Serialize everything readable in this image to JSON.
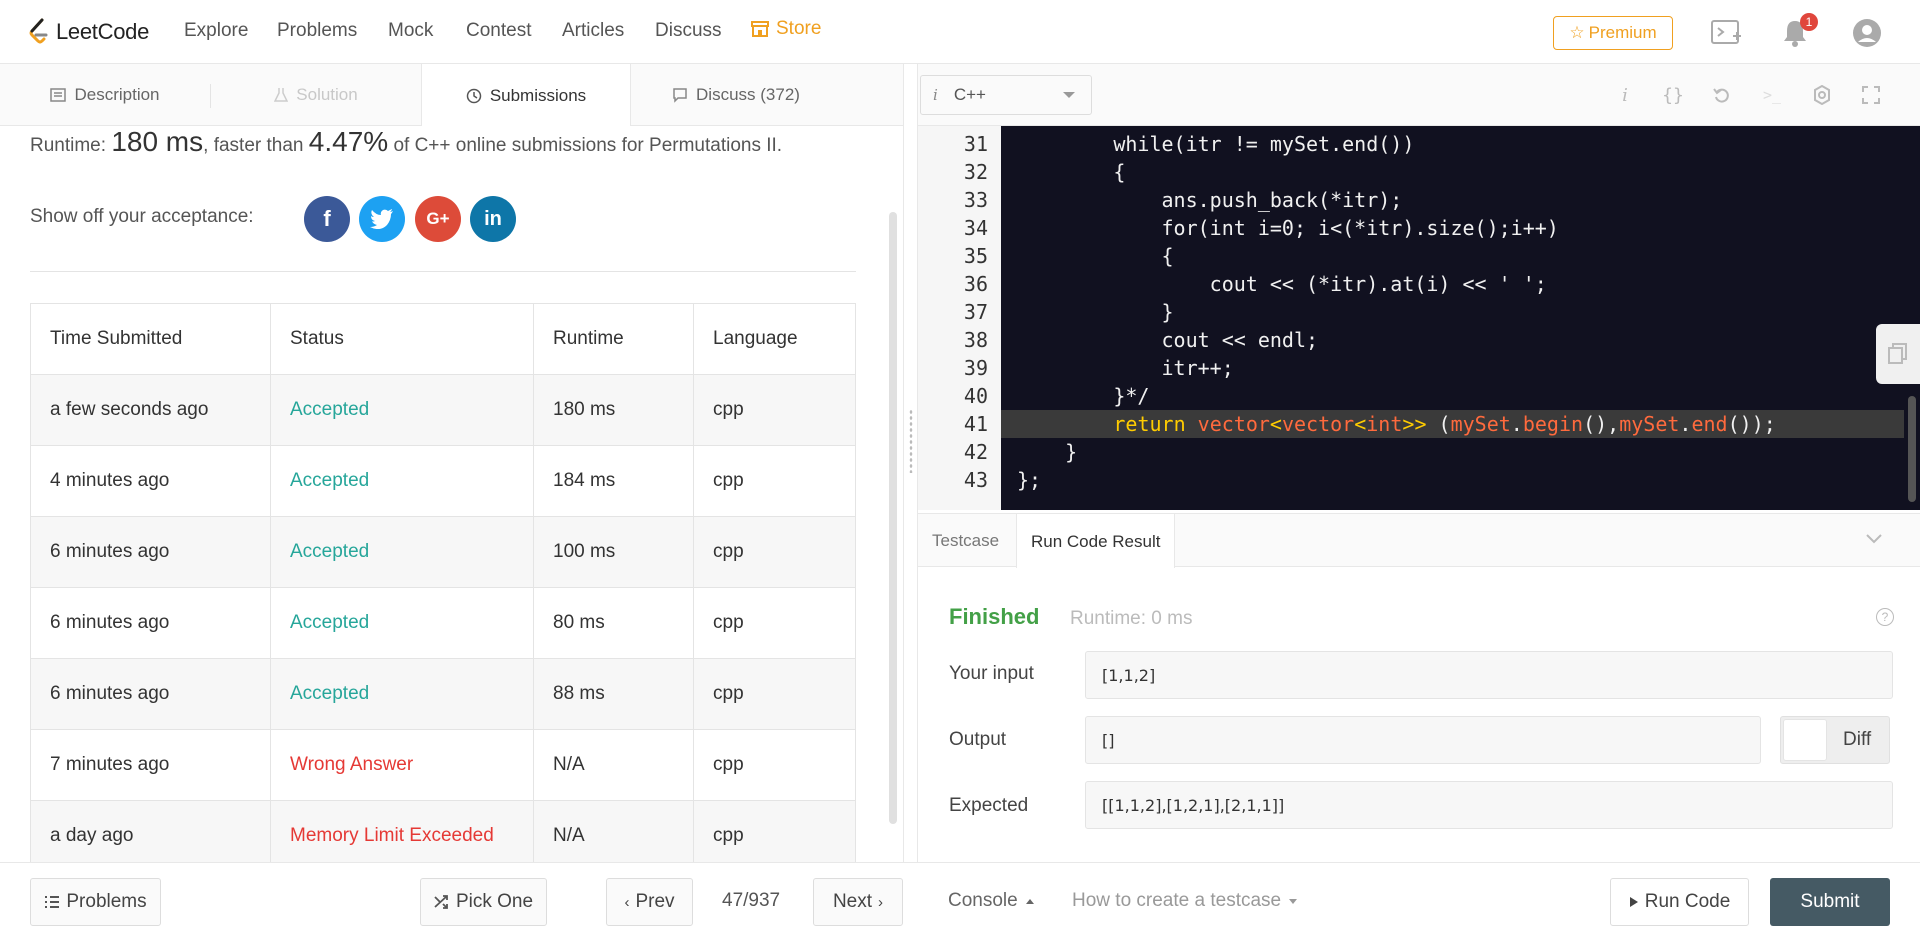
{
  "nav": {
    "logo_text": "LeetCode",
    "links": [
      "Explore",
      "Problems",
      "Mock",
      "Contest",
      "Articles",
      "Discuss"
    ],
    "store_label": "Store",
    "premium_label": "Premium",
    "notification_count": "1",
    "colors": {
      "store": "#f0a020",
      "premium": "#f0a020",
      "badge": "#e0463c"
    },
    "icons": [
      "playground-icon",
      "bell-icon",
      "user-avatar-icon"
    ]
  },
  "left_tabs": [
    {
      "label": "Description",
      "icon": "document-icon",
      "state": "normal"
    },
    {
      "label": "Solution",
      "icon": "flask-icon",
      "state": "disabled"
    },
    {
      "label": "Submissions",
      "icon": "clock-icon",
      "state": "active"
    },
    {
      "label": "Discuss (372)",
      "icon": "comments-icon",
      "state": "normal"
    }
  ],
  "summary": {
    "runtime_prefix": "Runtime: ",
    "runtime_value": "180 ms",
    "faster_text": ", faster than ",
    "percent": "4.47%",
    "suffix": " of C++ online submissions for Permutations II.",
    "share_label": "Show off your acceptance:",
    "share_icons": [
      "facebook-icon",
      "twitter-icon",
      "google-plus-icon",
      "linkedin-icon"
    ]
  },
  "submissions": {
    "headers": [
      "Time Submitted",
      "Status",
      "Runtime",
      "Language"
    ],
    "rows": [
      {
        "time": "a few seconds ago",
        "status": "Accepted",
        "runtime": "180 ms",
        "language": "cpp"
      },
      {
        "time": "4 minutes ago",
        "status": "Accepted",
        "runtime": "184 ms",
        "language": "cpp"
      },
      {
        "time": "6 minutes ago",
        "status": "Accepted",
        "runtime": "100 ms",
        "language": "cpp"
      },
      {
        "time": "6 minutes ago",
        "status": "Accepted",
        "runtime": "80 ms",
        "language": "cpp"
      },
      {
        "time": "6 minutes ago",
        "status": "Accepted",
        "runtime": "88 ms",
        "language": "cpp"
      },
      {
        "time": "7 minutes ago",
        "status": "Wrong Answer",
        "runtime": "N/A",
        "language": "cpp"
      },
      {
        "time": "a day ago",
        "status": "Memory Limit Exceeded",
        "runtime": "N/A",
        "language": "cpp"
      }
    ],
    "colors": {
      "accepted": "#26a69a",
      "error": "#e53935"
    }
  },
  "editor": {
    "language": "C++",
    "toolbar_icons": [
      "info-icon",
      "braces-icon",
      "reset-icon",
      "terminal-icon",
      "settings-icon",
      "fullscreen-icon"
    ],
    "lines": [
      {
        "n": "31",
        "code": "        while(itr != mySet.end())"
      },
      {
        "n": "32",
        "code": "        {"
      },
      {
        "n": "33",
        "code": "            ans.push_back(*itr);"
      },
      {
        "n": "34",
        "code": "            for(int i=0; i<(*itr).size();i++)"
      },
      {
        "n": "35",
        "code": "            {"
      },
      {
        "n": "36",
        "code": "                cout << (*itr).at(i) << ' ';"
      },
      {
        "n": "37",
        "code": "            }"
      },
      {
        "n": "38",
        "code": "            cout << endl;"
      },
      {
        "n": "39",
        "code": "            itr++;"
      },
      {
        "n": "40",
        "code": "        }*/"
      },
      {
        "n": "41",
        "code": "        return vector<vector<int>> (mySet.begin(),mySet.end());"
      },
      {
        "n": "42",
        "code": "    }"
      },
      {
        "n": "43",
        "code": "};"
      }
    ]
  },
  "console": {
    "tabs": [
      "Testcase",
      "Run Code Result"
    ],
    "status": "Finished",
    "runtime": "Runtime: 0 ms",
    "input_label": "Your input",
    "input_value": "[1,1,2]",
    "output_label": "Output",
    "output_value": "[]",
    "expected_label": "Expected",
    "expected_value": "[[1,1,2],[1,2,1],[2,1,1]]",
    "diff_label": "Diff",
    "colors": {
      "finished": "#43a047"
    }
  },
  "bottom": {
    "problems_label": "Problems",
    "pick_one_label": "Pick One",
    "prev_label": "Prev",
    "page_count": "47/937",
    "next_label": "Next",
    "console_label": "Console",
    "testcase_help_label": "How to create a testcase",
    "run_code_label": "Run Code",
    "submit_label": "Submit",
    "colors": {
      "submit": "#455a64"
    }
  }
}
